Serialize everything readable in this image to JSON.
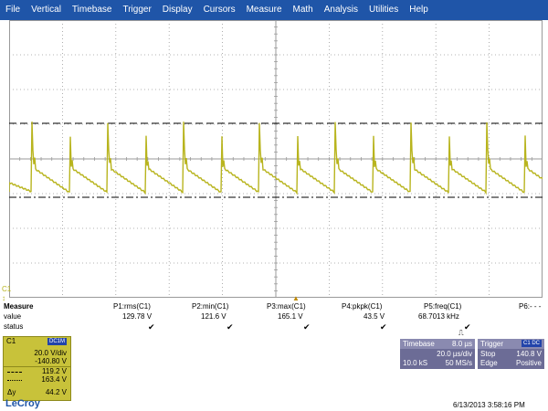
{
  "menu": [
    "File",
    "Vertical",
    "Timebase",
    "Trigger",
    "Display",
    "Cursors",
    "Measure",
    "Math",
    "Analysis",
    "Utilities",
    "Help"
  ],
  "channel_marker": "C1",
  "measure": {
    "label_measure": "Measure",
    "label_value": "value",
    "label_status": "status",
    "params": [
      {
        "name": "P1:rms(C1)",
        "value": "129.78 V",
        "status": "✔"
      },
      {
        "name": "P2:min(C1)",
        "value": "121.6 V",
        "status": "✔"
      },
      {
        "name": "P3:max(C1)",
        "value": "165.1 V",
        "status": "✔"
      },
      {
        "name": "P4:pkpk(C1)",
        "value": "43.5 V",
        "status": "✔"
      },
      {
        "name": "P5:freq(C1)",
        "value": "68.7013 kHz",
        "status": "✔"
      },
      {
        "name": "P6:- - -",
        "value": "",
        "status": ""
      }
    ]
  },
  "c1_panel": {
    "label": "C1",
    "coupling": "DC1M",
    "vdiv": "20.0 V/div",
    "offset": "-140.80 V",
    "cursor1": "119.2 V",
    "cursor2": "163.4 V",
    "delta_label": "Δy",
    "delta": "44.2 V"
  },
  "timebase": {
    "title": "Timebase",
    "delay": "8.0 µs",
    "tdiv": "20.0 µs/div",
    "samples": "10.0 kS",
    "rate": "50 MS/s"
  },
  "trigger": {
    "title": "Trigger",
    "badge": "C1 DC",
    "mode_label": "Stop",
    "level": "140.8 V",
    "type_label": "Edge",
    "slope": "Positive"
  },
  "footer": {
    "brand": "LeCroy",
    "datetime": "6/13/2013 3:58:16 PM"
  },
  "colors": {
    "menubar": "#1f55a8",
    "trace": "#b8b41e",
    "grid": "#9a9a9a"
  }
}
